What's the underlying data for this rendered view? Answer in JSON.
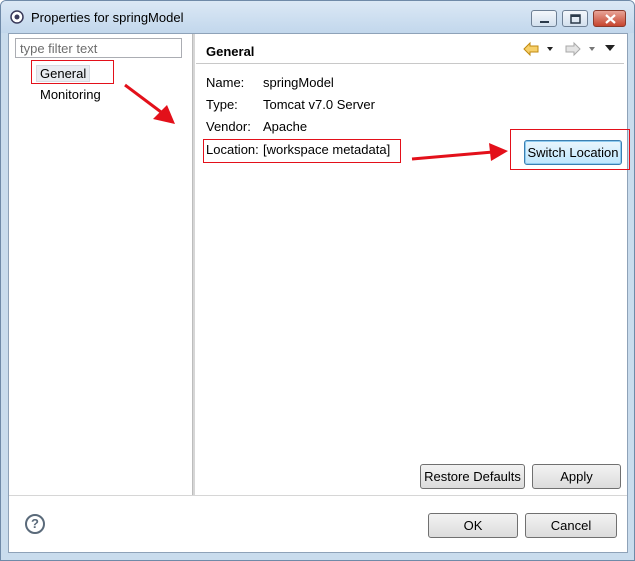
{
  "window": {
    "title": "Properties for springModel"
  },
  "filter": {
    "placeholder": "type filter text"
  },
  "tree": {
    "items": [
      "General",
      "Monitoring"
    ]
  },
  "panel": {
    "title": "General",
    "name_label": "Name:",
    "name_value": "springModel",
    "type_label": "Type:",
    "type_value": "Tomcat v7.0 Server",
    "vendor_label": "Vendor:",
    "vendor_value": "Apache",
    "location_label": "Location:",
    "location_value": "[workspace metadata]",
    "switch_location": "Switch Location",
    "restore_defaults": "Restore Defaults",
    "apply": "Apply"
  },
  "footer": {
    "ok": "OK",
    "cancel": "Cancel",
    "help_glyph": "?"
  },
  "colors": {
    "annotation": "#e3101a",
    "nav_arrow": "#e6a81b",
    "focus_border": "#3c7fb1"
  }
}
